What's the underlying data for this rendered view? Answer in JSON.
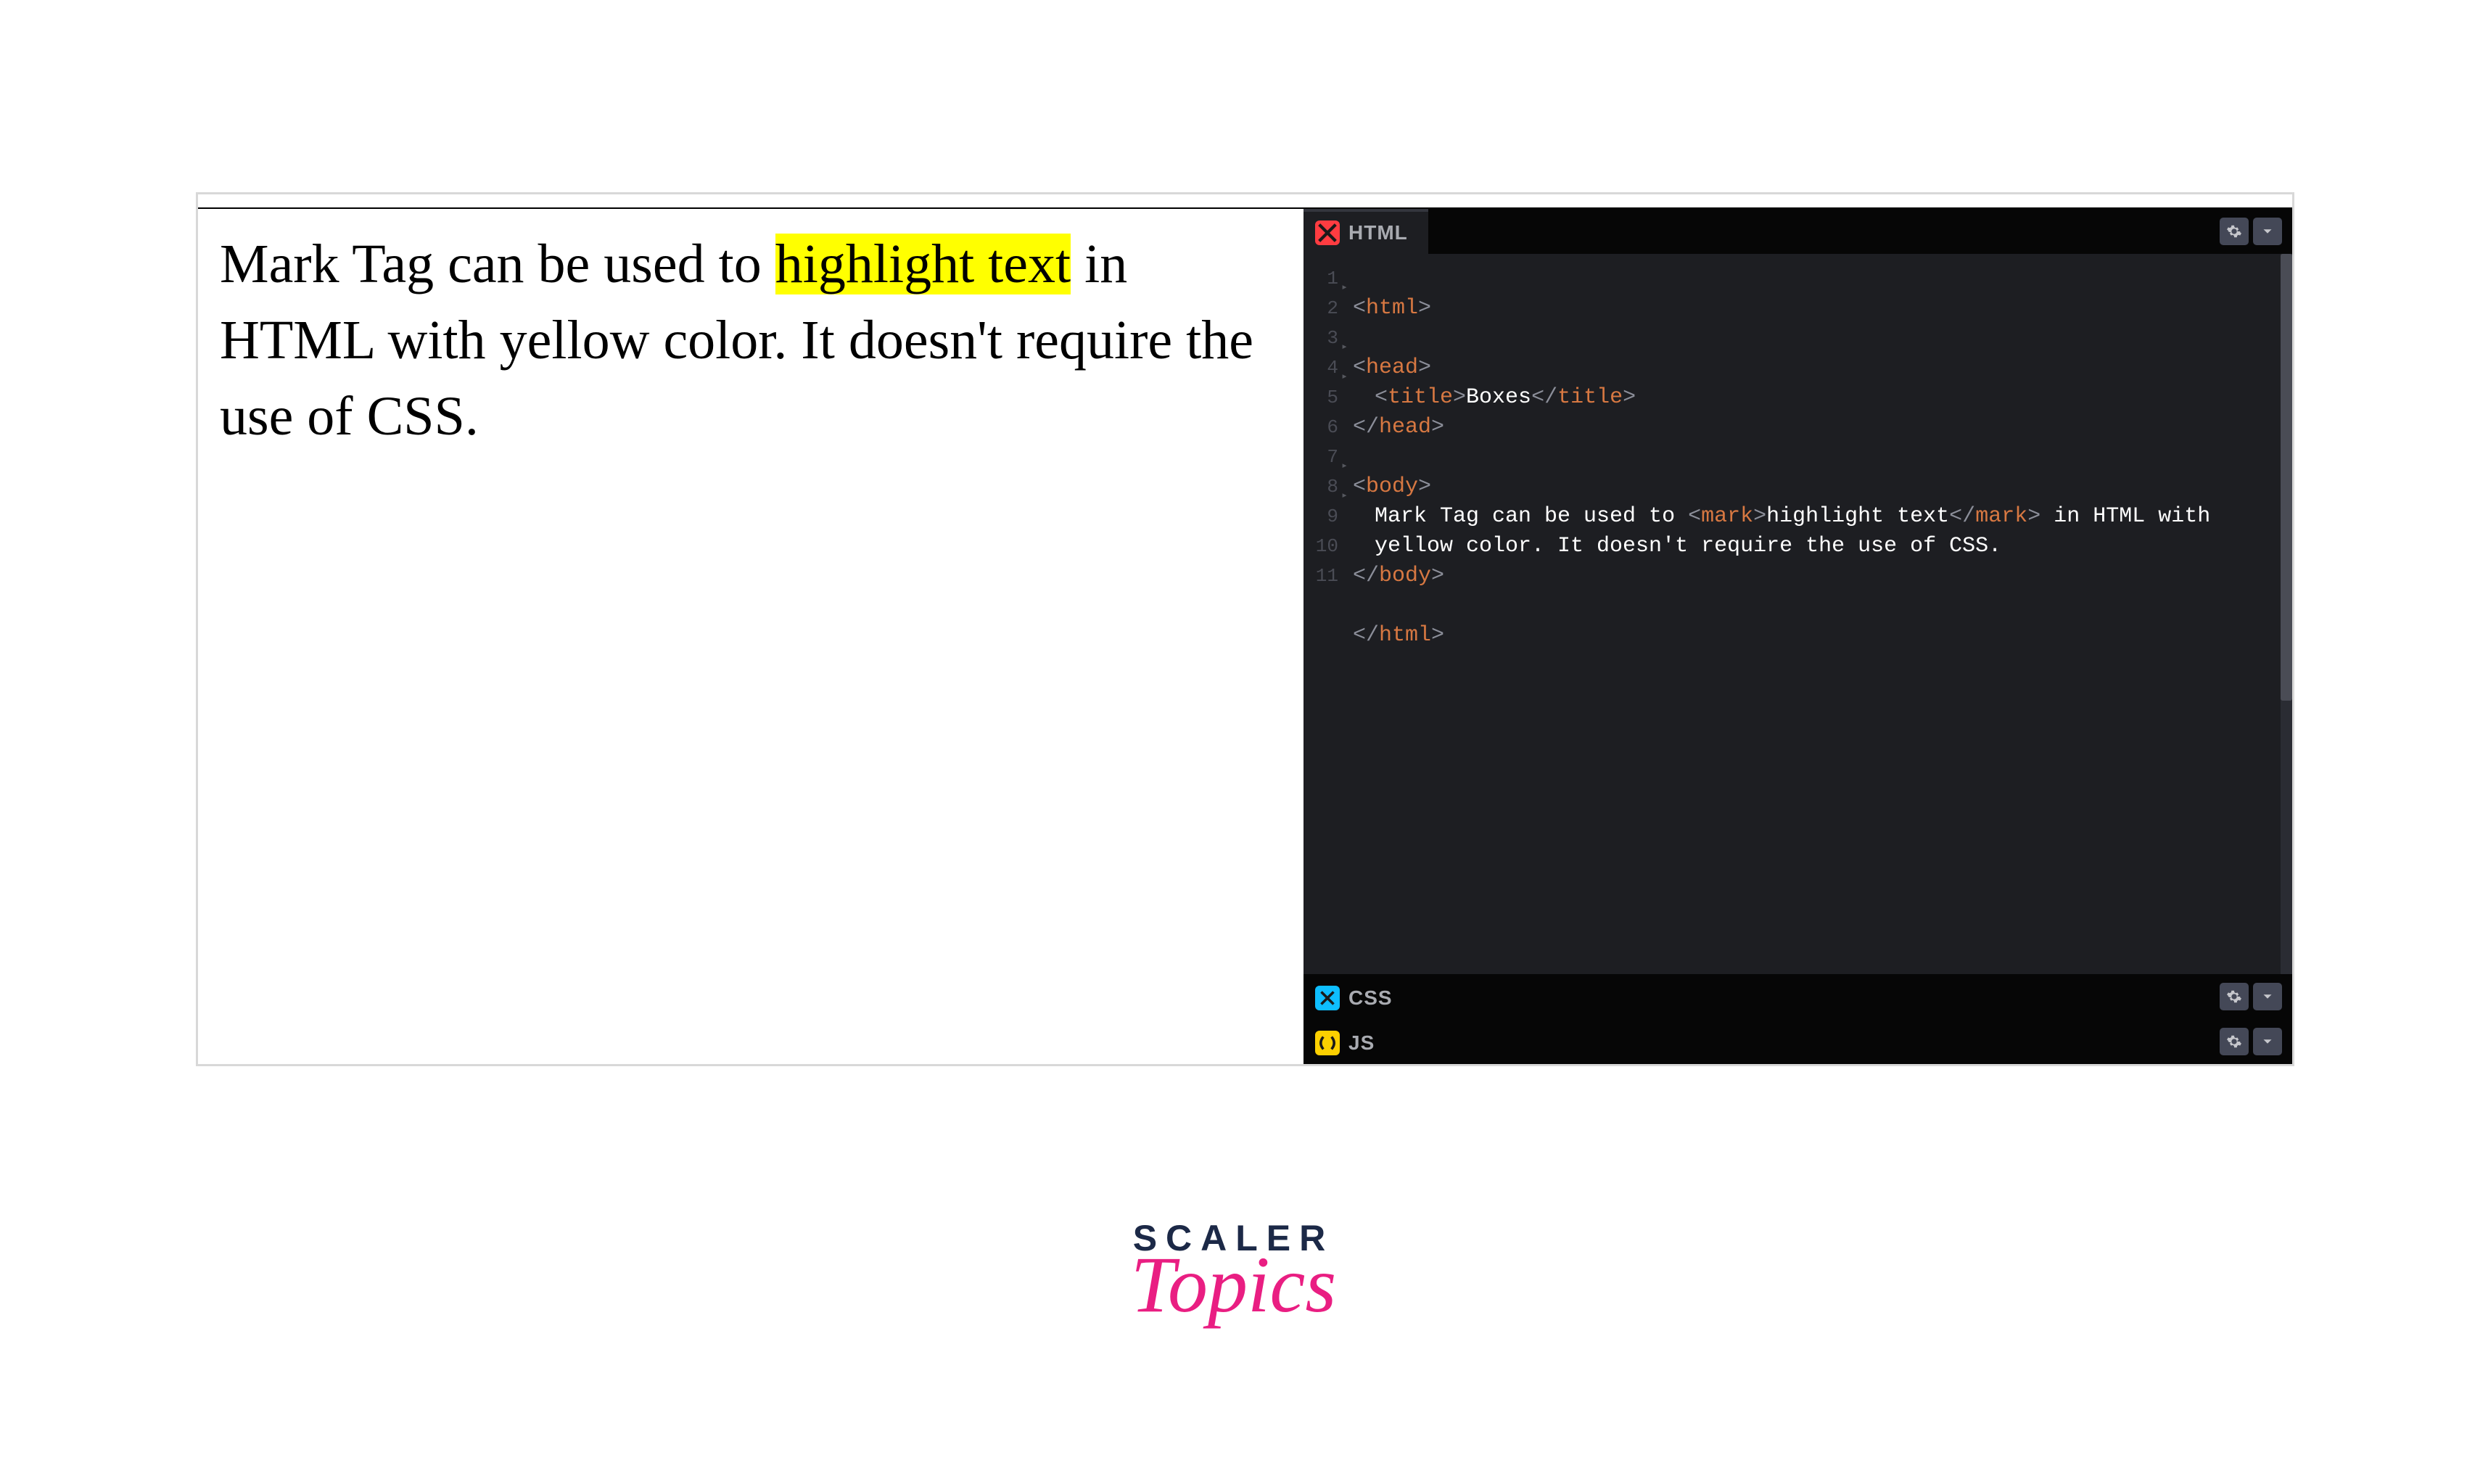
{
  "preview": {
    "before": "Mark Tag can be used to ",
    "highlight": "highlight text",
    "after": " in HTML with yellow color. It doesn't require the use of CSS."
  },
  "panels": {
    "html": {
      "label": "HTML",
      "badge": "/"
    },
    "css": {
      "label": "CSS",
      "badge": "*"
    },
    "js": {
      "label": "JS",
      "badge": "( )"
    }
  },
  "gutter": [
    "1",
    "2",
    "3",
    "4",
    "5",
    "6",
    "7",
    "8",
    "",
    "9",
    "10",
    "11"
  ],
  "code": {
    "l1_open": "<",
    "l1_tag": "html",
    "l1_close": ">",
    "l3_open": "<",
    "l3_tag": "head",
    "l3_close": ">",
    "l4_open": "<",
    "l4_tag": "title",
    "l4_close": ">",
    "l4_text": "Boxes",
    "l4_eopen": "</",
    "l4_etag": "title",
    "l4_eclose": ">",
    "l5_open": "</",
    "l5_tag": "head",
    "l5_close": ">",
    "l7_open": "<",
    "l7_tag": "body",
    "l7_close": ">",
    "l8_text_before": "Mark Tag can be used to ",
    "l8_mopen": "<",
    "l8_mtag": "mark",
    "l8_mclose": ">",
    "l8_mark_text": "highlight text",
    "l8_meopen": "</",
    "l8_metag": "mark",
    "l8_meclose": ">",
    "l8_text_after": " in HTML with yellow color. It doesn't require the use of CSS.",
    "l9_open": "</",
    "l9_tag": "body",
    "l9_close": ">",
    "l11_open": "</",
    "l11_tag": "html",
    "l11_close": ">"
  },
  "branding": {
    "line1": "SCALER",
    "line2": "Topics"
  }
}
